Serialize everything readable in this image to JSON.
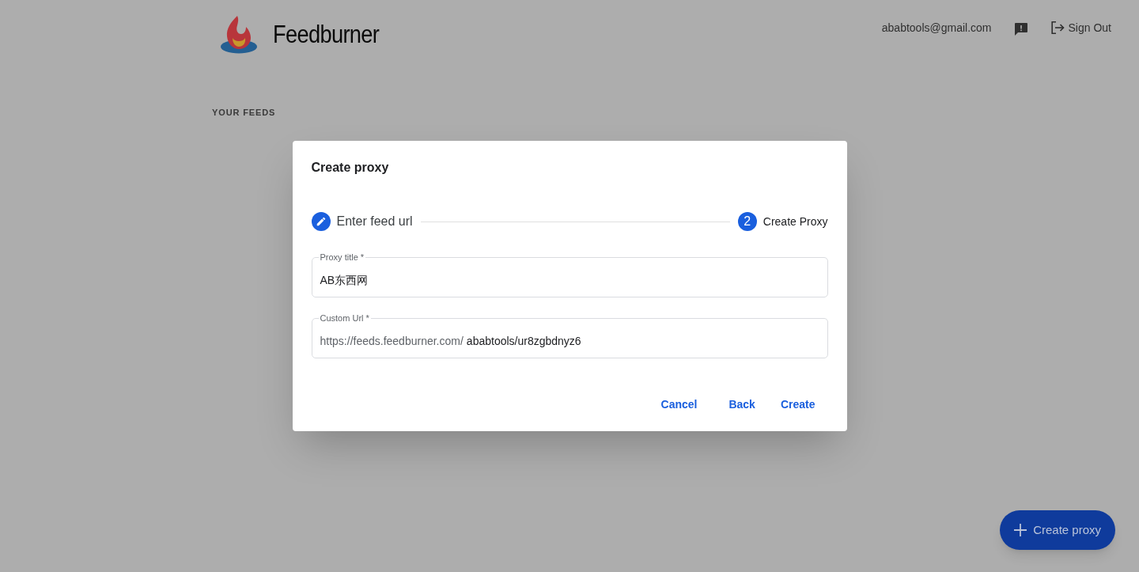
{
  "header": {
    "brand": "Feedburner",
    "email": "ababtools@gmail.com",
    "sign_out": "Sign Out"
  },
  "section_title": "YOUR FEEDS",
  "dialog": {
    "title": "Create proxy",
    "steps": [
      {
        "label": "Enter feed url",
        "kind": "edit",
        "selected": false
      },
      {
        "label": "Create Proxy",
        "kind": "number",
        "number": "2",
        "selected": true
      }
    ],
    "fields": [
      {
        "label": "Proxy title *",
        "value": "AB东西网"
      },
      {
        "label": "Custom Url *",
        "prefix": "https://feeds.feedburner.com/",
        "value": "ababtools/ur8zgbdnyz6"
      }
    ],
    "buttons": [
      "Cancel",
      "Back",
      "Create"
    ]
  },
  "fab": {
    "label": "Create proxy"
  }
}
